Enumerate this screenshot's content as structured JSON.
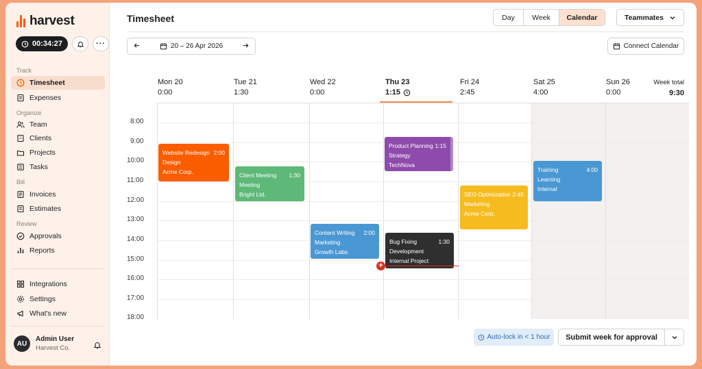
{
  "app": {
    "logo_text": "harvest"
  },
  "sidebar": {
    "timer": "00:34:27",
    "sections": {
      "track": "Track",
      "organize": "Organize",
      "bill": "Bill",
      "review": "Review"
    },
    "items": [
      {
        "label": "Timesheet",
        "icon": "clock-icon",
        "active": true
      },
      {
        "label": "Expenses",
        "icon": "receipt-icon"
      },
      {
        "label": "Team",
        "icon": "users-icon"
      },
      {
        "label": "Clients",
        "icon": "building-icon"
      },
      {
        "label": "Projects",
        "icon": "folder-icon"
      },
      {
        "label": "Tasks",
        "icon": "tasks-icon"
      },
      {
        "label": "Invoices",
        "icon": "invoice-icon"
      },
      {
        "label": "Estimates",
        "icon": "estimate-icon"
      },
      {
        "label": "Approvals",
        "icon": "check-circle-icon"
      },
      {
        "label": "Reports",
        "icon": "bar-chart-icon"
      },
      {
        "label": "Integrations",
        "icon": "integrations-icon"
      },
      {
        "label": "Settings",
        "icon": "gear-icon"
      },
      {
        "label": "What's new",
        "icon": "megaphone-icon"
      }
    ],
    "user": {
      "initials": "AU",
      "name": "Admin User",
      "org": "Harvest Co."
    }
  },
  "header": {
    "title": "Timesheet",
    "views": [
      "Day",
      "Week",
      "Calendar"
    ],
    "selected_view": "Calendar",
    "teammates": "Teammates",
    "date_range": "20 – 26 Apr 2026",
    "connect_calendar": "Connect Calendar"
  },
  "calendar": {
    "days": [
      {
        "name": "Mon 20",
        "hours": "0:00"
      },
      {
        "name": "Tue 21",
        "hours": "1:30"
      },
      {
        "name": "Wed 22",
        "hours": "0:00"
      },
      {
        "name": "Thu 23",
        "hours": "1:15",
        "today": true
      },
      {
        "name": "Fri 24",
        "hours": "2:45"
      },
      {
        "name": "Sat 25",
        "hours": "4:00"
      },
      {
        "name": "Sun 26",
        "hours": "0:00"
      }
    ],
    "week_total_label": "Week total",
    "week_total": "9:30",
    "times": [
      "8:00",
      "9:00",
      "10:00",
      "11:00",
      "12:00",
      "13:00",
      "14:00",
      "15:00",
      "16:00",
      "17:00",
      "18:00"
    ],
    "events": [
      {
        "title": "Website Redesign",
        "duration": "2:00",
        "task": "Design",
        "client": "Acme Corp.",
        "color": "#fa5d00"
      },
      {
        "title": "Client Meeting",
        "duration": "1:30",
        "task": "Meeting",
        "client": "Bright Ltd.",
        "color": "#5eb878"
      },
      {
        "title": "Content Writing",
        "duration": "2:00",
        "task": "Marketing",
        "client": "Growth Labs",
        "color": "#4a98d3"
      },
      {
        "title": "Product Planning",
        "duration": "1:15",
        "task": "Strategy",
        "client": "TechNova",
        "color": "#8e4bab"
      },
      {
        "title": "Bug Fixing",
        "duration": "1:30",
        "task": "Development",
        "client": "Internal Project",
        "color": "#2f2f2f"
      },
      {
        "title": "SEO Optimization",
        "duration": "2:45",
        "task": "Marketing",
        "client": "Acme Corp.",
        "color": "#f6bc1f"
      },
      {
        "title": "Training",
        "duration": "4:00",
        "task": "Learning",
        "client": "Internal",
        "color": "#4a98d3"
      }
    ]
  },
  "footer": {
    "autolock": "Auto-lock in < 1 hour",
    "submit": "Submit week for approval"
  }
}
